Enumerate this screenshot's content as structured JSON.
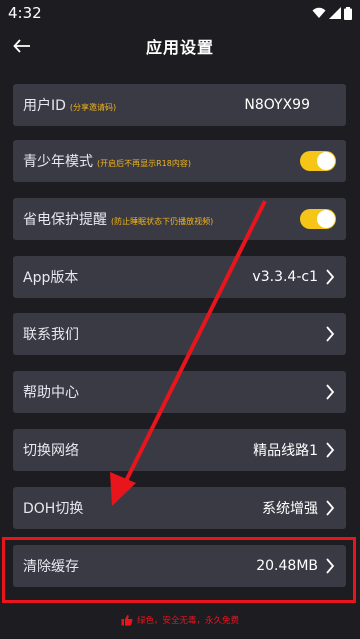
{
  "statusbar": {
    "time": "4:32"
  },
  "appbar": {
    "title": "应用设置"
  },
  "rows": [
    {
      "label": "用户ID",
      "hint": "(分享邀请码)",
      "value": "N8OYX99"
    },
    {
      "label": "青少年模式",
      "hint": "(开启后不再显示R18内容)",
      "toggle_on": true
    },
    {
      "label": "省电保护提醒",
      "hint": "(防止睡眠状态下仍播放视频)",
      "toggle_on": true
    },
    {
      "label": "App版本",
      "value": "v3.3.4-c1"
    },
    {
      "label": "联系我们"
    },
    {
      "label": "帮助中心"
    },
    {
      "label": "切换网络",
      "value": "精品线路1"
    },
    {
      "label": "DOH切换",
      "value": "系统增强"
    },
    {
      "label": "清除缓存",
      "value": "20.48MB"
    }
  ],
  "footer": {
    "text": "绿色，安全无毒，永久免费"
  },
  "colors": {
    "accent": "#f5c518",
    "annotation": "#e8151d",
    "background": "#1c1c21",
    "row_bg": "#3a3a44"
  },
  "icons": [
    "back-arrow-icon",
    "chevron-right-icon",
    "thumbs-up-icon",
    "wifi-icon",
    "signal-icon",
    "battery-icon"
  ]
}
